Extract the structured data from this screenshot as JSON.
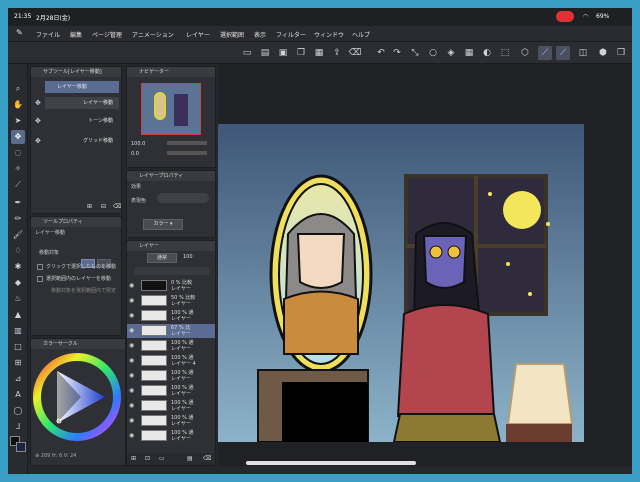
{
  "status": {
    "time": "21:35",
    "date": "2月28日(金)",
    "battery": "69%"
  },
  "menu": {
    "items": [
      "ファイル",
      "編集",
      "ページ管理",
      "アニメーション",
      "レイヤー",
      "選択範囲",
      "表示",
      "フィルター",
      "ウィンドウ",
      "ヘルプ"
    ]
  },
  "sub_tool_panel": {
    "title": "サブツール[レイヤー移動]",
    "items": [
      "レイヤー移動",
      "レイヤー移動",
      "トーン移動",
      "グリッド移動"
    ]
  },
  "tool_property_panel": {
    "title": "ツールプロパティ",
    "section": "レイヤー移動",
    "move_target_label": "移動対象",
    "option1": "クリックで選択したものを移動",
    "option2": "選択範囲内のレイヤーを移動",
    "note": "移動対象を選択範囲内で限定"
  },
  "color_panel": {
    "title": "カラーサークル",
    "hint": "⊕ 209 H: 6 V: 24"
  },
  "navigator": {
    "title": "ナビゲーター",
    "zoom": "100.0",
    "angle": "0.0"
  },
  "layer_property": {
    "title": "レイヤープロパティ",
    "effect_label": "効果",
    "display_color_label": "表現色",
    "display_color_value": "カラー"
  },
  "layer_panel": {
    "title": "レイヤー",
    "blend_mode": "通常",
    "opacity": "100",
    "layers": [
      {
        "pct": "0 % 比較",
        "name": "レイヤー"
      },
      {
        "pct": "50 % 比較",
        "name": "レイヤー"
      },
      {
        "pct": "100 % 通",
        "name": "レイヤー"
      },
      {
        "pct": "67 % 比",
        "name": "レイヤー"
      },
      {
        "pct": "100 % 通",
        "name": "レイヤー"
      },
      {
        "pct": "100 % 通",
        "name": "レイヤー 4"
      },
      {
        "pct": "100 % 通",
        "name": "レイヤー"
      },
      {
        "pct": "100 % 通",
        "name": "レイヤー"
      },
      {
        "pct": "100 % 通",
        "name": "レイヤー"
      },
      {
        "pct": "100 % 通",
        "name": "レイヤー"
      },
      {
        "pct": "100 % 通",
        "name": "レイヤー"
      }
    ]
  },
  "colors": {
    "accent": "#5b6c92",
    "panel": "#2f3035"
  }
}
